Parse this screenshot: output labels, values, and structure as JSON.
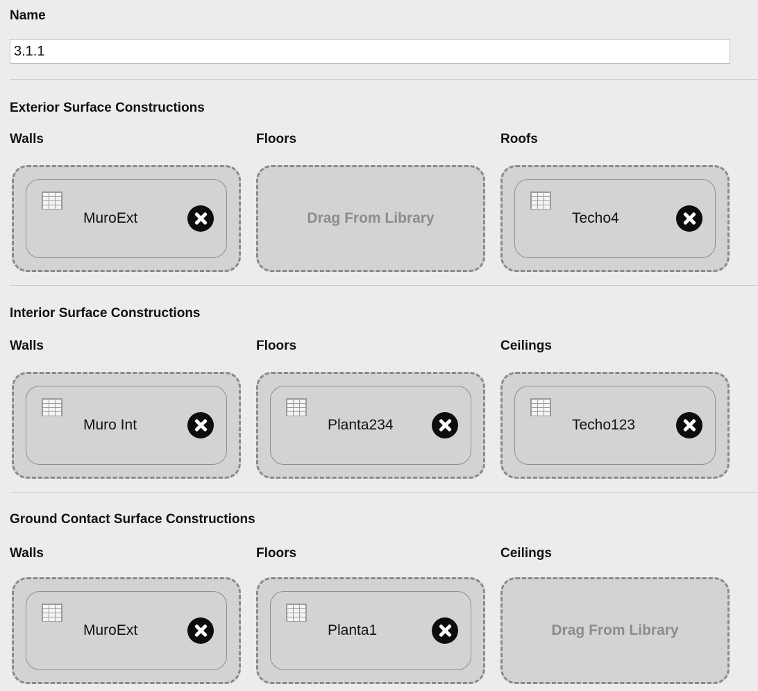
{
  "name": {
    "label": "Name",
    "value": "3.1.1"
  },
  "exterior": {
    "title": "Exterior Surface Constructions",
    "walls": {
      "label": "Walls",
      "item": "MuroExt"
    },
    "floors": {
      "label": "Floors",
      "placeholder": "Drag From Library"
    },
    "roofs": {
      "label": "Roofs",
      "item": "Techo4"
    }
  },
  "interior": {
    "title": "Interior Surface Constructions",
    "walls": {
      "label": "Walls",
      "item": "Muro Int"
    },
    "floors": {
      "label": "Floors",
      "item": "Planta234"
    },
    "ceilings": {
      "label": "Ceilings",
      "item": "Techo123"
    }
  },
  "ground": {
    "title": "Ground Contact Surface Constructions",
    "walls": {
      "label": "Walls",
      "item": "MuroExt"
    },
    "floors": {
      "label": "Floors",
      "item": "Planta1"
    },
    "ceilings": {
      "label": "Ceilings",
      "placeholder": "Drag From Library"
    }
  },
  "icons": {
    "construction": "brick-icon",
    "remove": "close-circle-icon"
  }
}
